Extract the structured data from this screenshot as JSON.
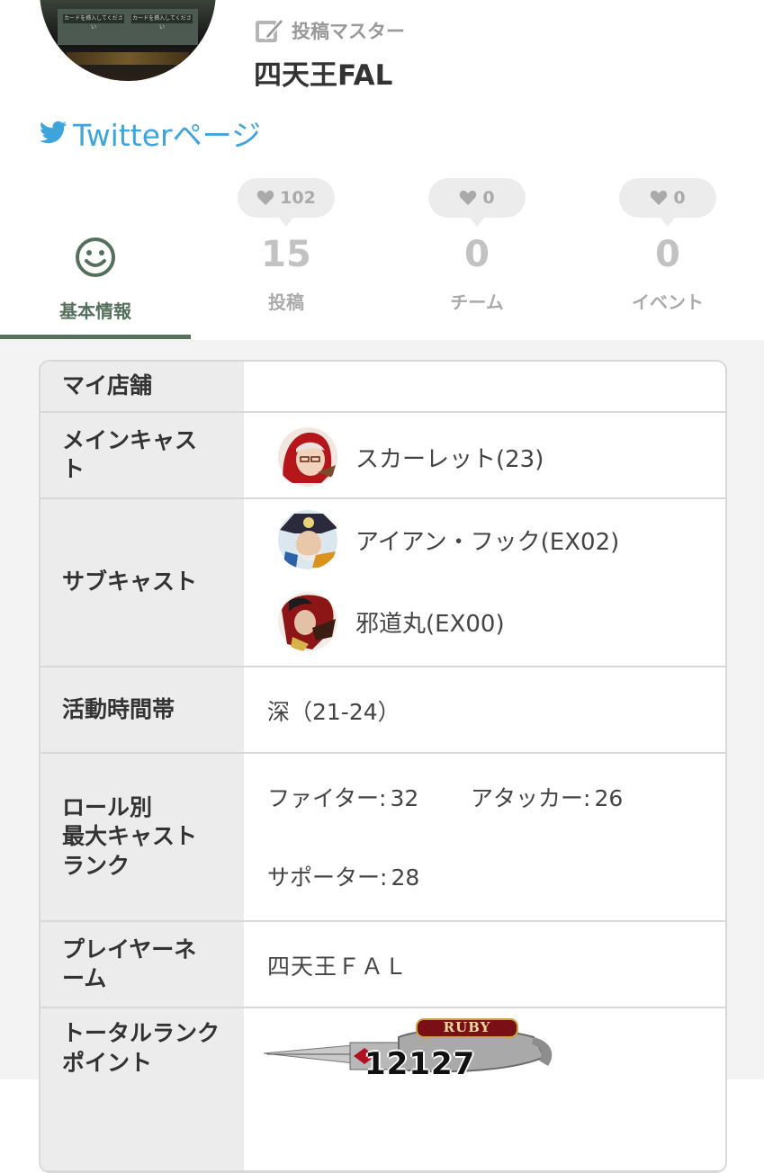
{
  "profile": {
    "badge_label": "投稿マスター",
    "username": "四天王FAL",
    "twitter_label": "Twitterページ",
    "avatar_screen_text_left": "カードを挿入してください",
    "avatar_screen_text_right": "カードを挿入してください"
  },
  "tabs": [
    {
      "label": "基本情報",
      "icon": "smile-icon",
      "active": true
    },
    {
      "label": "投稿",
      "count": "15",
      "likes": "102"
    },
    {
      "label": "チーム",
      "count": "0",
      "likes": "0"
    },
    {
      "label": "イベント",
      "count": "0",
      "likes": "0"
    }
  ],
  "info": {
    "my_store": {
      "label": "マイ店舗",
      "value": ""
    },
    "main_cast": {
      "label": "メインキャスト",
      "casts": [
        {
          "name": "スカーレット(23)",
          "icon": "scarlet-cast-icon"
        }
      ]
    },
    "sub_cast": {
      "label": "サブキャスト",
      "casts": [
        {
          "name": "アイアン・フック(EX02)",
          "icon": "iron-hook-cast-icon"
        },
        {
          "name": "邪道丸(EX00)",
          "icon": "jadoumaru-cast-icon"
        }
      ]
    },
    "active_time": {
      "label": "活動時間帯",
      "value": "深（21-24）"
    },
    "role_rank": {
      "label": "ロール別\n最大キャスト\nランク",
      "fighter_label": "ファイター:",
      "fighter_value": "32",
      "attacker_label": "アタッカー:",
      "attacker_value": "26",
      "supporter_label": "サポーター:",
      "supporter_value": "28"
    },
    "player_name": {
      "label": "プレイヤーネーム",
      "value": "四天王ＦＡＬ"
    },
    "total_rank_points": {
      "label": "トータルランクポイント",
      "rank_name": "RUBY",
      "points": "12127"
    }
  },
  "colors": {
    "accent": "#55705d",
    "twitter": "#3ea4dc",
    "muted": "#aaaaaa",
    "ruby": "#8a0f14"
  }
}
